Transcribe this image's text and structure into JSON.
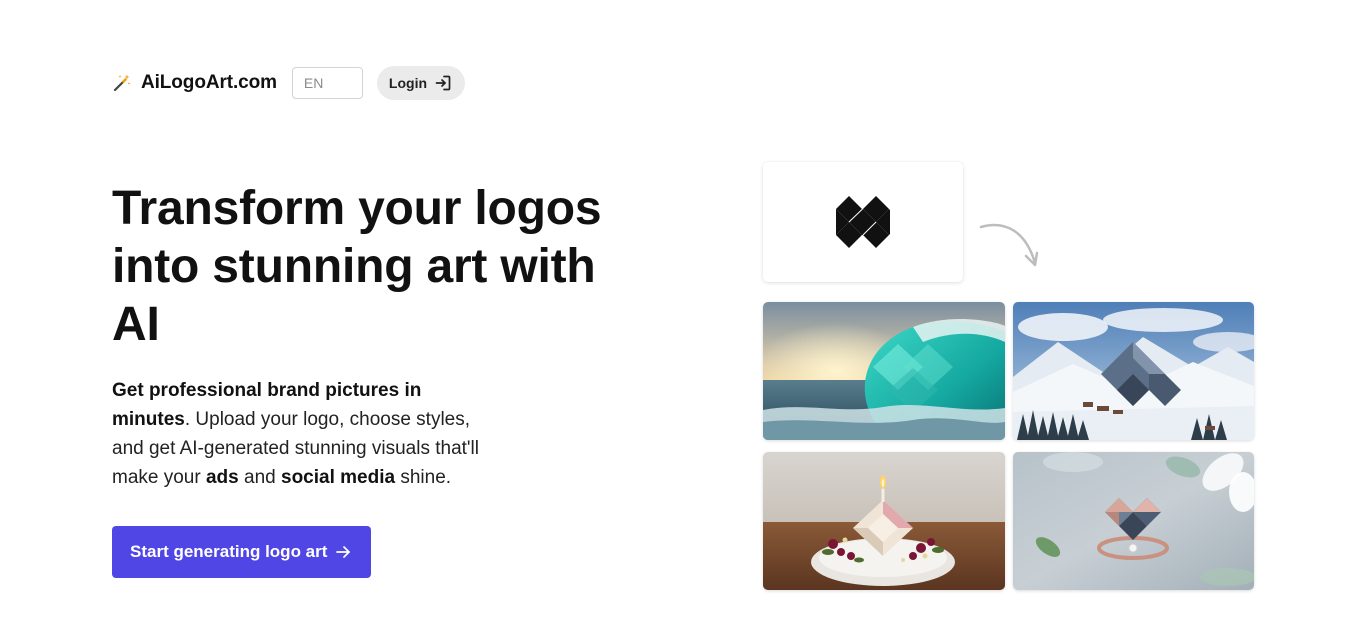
{
  "header": {
    "brand_name": "AiLogoArt.com",
    "brand_icon": "magic-wand-icon",
    "language": "EN",
    "login_label": "Login",
    "login_icon": "sign-in-icon"
  },
  "hero": {
    "title": "Transform your logos into stunning art with AI",
    "subtitle": {
      "strong_lead": "Get professional brand pictures in minutes",
      "text1": ". Upload your logo, choose styles, and get AI-generated stunning visuals that'll make your ",
      "strong_ads": "ads",
      "text2": " and ",
      "strong_social": "social media",
      "text3": " shine."
    },
    "cta_label": "Start generating logo art",
    "cta_icon": "arrow-right-icon"
  },
  "showcase": {
    "source_logo": "diamond-logo",
    "arrow_icon": "curved-arrow-icon",
    "images": [
      {
        "name": "ocean-wave-logo-art"
      },
      {
        "name": "snowy-mountain-logo-art"
      },
      {
        "name": "candle-cake-logo-art"
      },
      {
        "name": "ring-jewelry-logo-art"
      }
    ]
  },
  "colors": {
    "accent": "#4f46e5",
    "login_bg": "#ebebeb",
    "text": "#111111"
  }
}
